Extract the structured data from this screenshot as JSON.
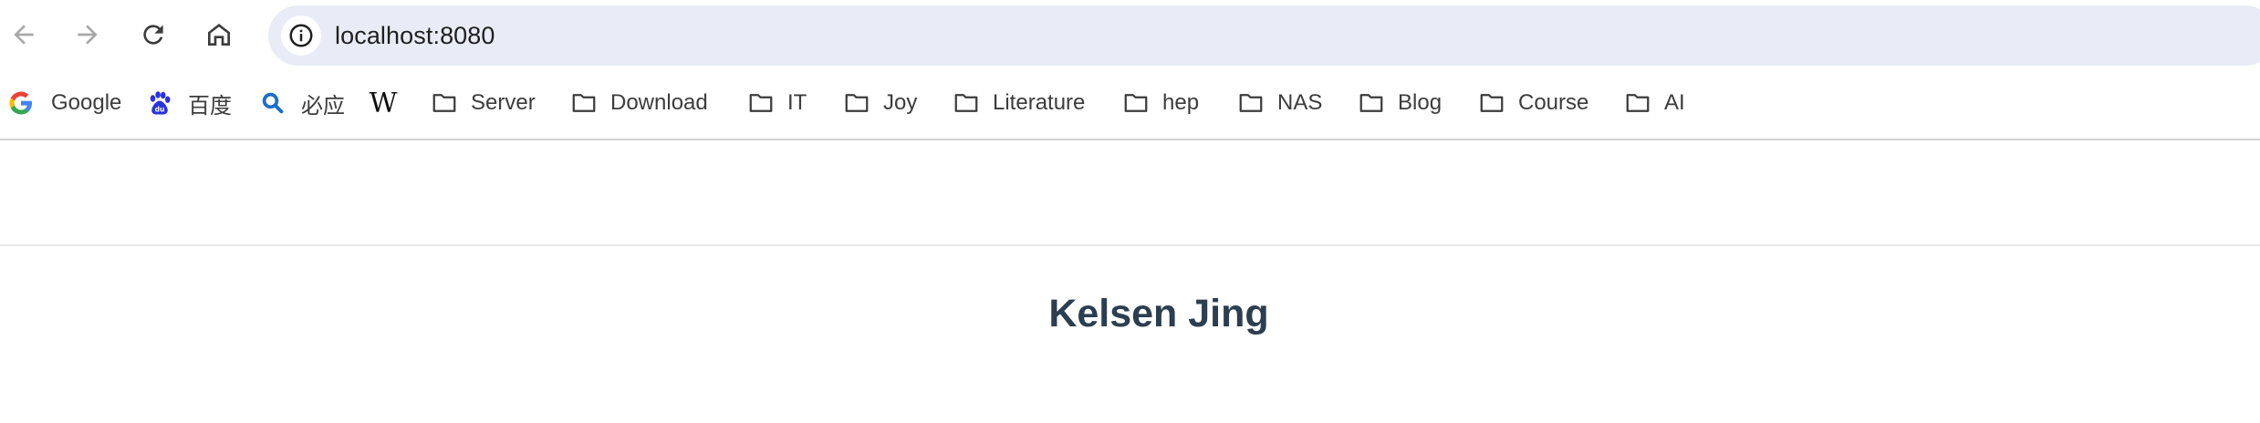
{
  "toolbar": {
    "back_icon": "arrow-left-icon",
    "forward_icon": "arrow-right-icon",
    "reload_icon": "reload-icon",
    "home_icon": "home-icon",
    "site_info_icon": "info-icon",
    "url": "localhost:8080"
  },
  "bookmarks": [
    {
      "label": "Google",
      "icon": "google-icon"
    },
    {
      "label": "百度",
      "icon": "baidu-icon"
    },
    {
      "label": "必应",
      "icon": "bing-search-icon"
    },
    {
      "label": "",
      "icon": "wikipedia-icon",
      "glyph": "W"
    },
    {
      "label": "Server",
      "icon": "folder-icon"
    },
    {
      "label": "Download",
      "icon": "folder-icon"
    },
    {
      "label": "IT",
      "icon": "folder-icon"
    },
    {
      "label": "Joy",
      "icon": "folder-icon"
    },
    {
      "label": "Literature",
      "icon": "folder-icon"
    },
    {
      "label": "hep",
      "icon": "folder-icon"
    },
    {
      "label": "NAS",
      "icon": "folder-icon"
    },
    {
      "label": "Blog",
      "icon": "folder-icon"
    },
    {
      "label": "Course",
      "icon": "folder-icon"
    },
    {
      "label": "AI",
      "icon": "folder-icon"
    }
  ],
  "page": {
    "title": "Kelsen Jing"
  },
  "colors": {
    "omnibox_bg": "#e9ecf6",
    "title_color": "#2c3e50",
    "baidu_blue": "#2932e1",
    "bing_blue": "#1a6fc9"
  }
}
